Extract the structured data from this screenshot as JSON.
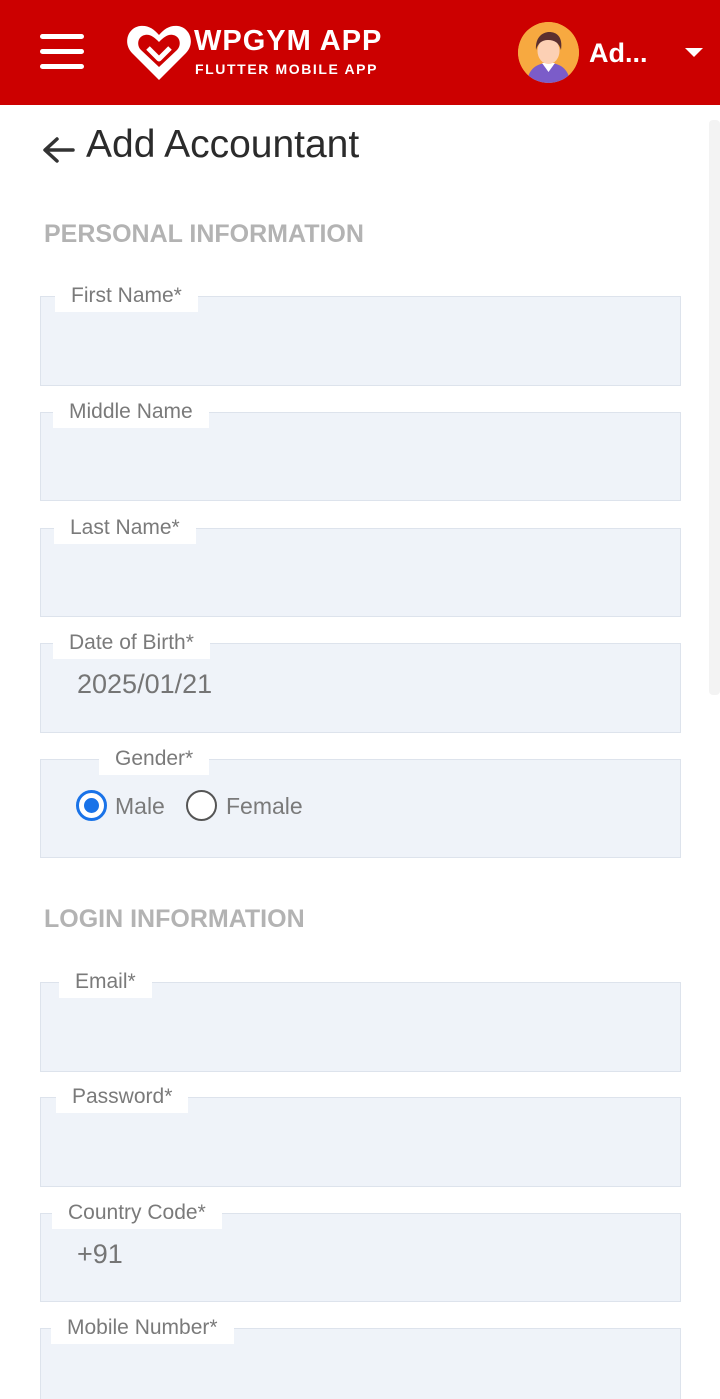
{
  "header": {
    "brand_title": "WPGYM APP",
    "brand_subtitle": "FLUTTER MOBILE APP",
    "user_name": "Ad...",
    "color": "#cc0000"
  },
  "page": {
    "title": "Add Accountant"
  },
  "sections": {
    "personal": "PERSONAL INFORMATION",
    "login": "LOGIN INFORMATION"
  },
  "fields": {
    "first_name": {
      "label": "First Name*",
      "value": ""
    },
    "middle_name": {
      "label": "Middle Name",
      "value": ""
    },
    "last_name": {
      "label": "Last Name*",
      "value": ""
    },
    "dob": {
      "label": "Date of Birth*",
      "value": "2025/01/21"
    },
    "gender": {
      "label": "Gender*",
      "options": [
        "Male",
        "Female"
      ],
      "selected": "Male"
    },
    "email": {
      "label": "Email*",
      "value": ""
    },
    "password": {
      "label": "Password*",
      "value": ""
    },
    "country_code": {
      "label": "Country Code*",
      "value": "+91"
    },
    "mobile": {
      "label": "Mobile Number*",
      "value": ""
    }
  },
  "icons": {
    "menu": "hamburger-menu-icon",
    "logo": "heart-logo-icon",
    "avatar": "user-avatar",
    "dropdown": "caret-down-icon",
    "back": "arrow-left-icon"
  },
  "colors": {
    "accent": "#1a73e8",
    "field_bg": "#eff3f9",
    "section_text": "#b3b3b3"
  }
}
